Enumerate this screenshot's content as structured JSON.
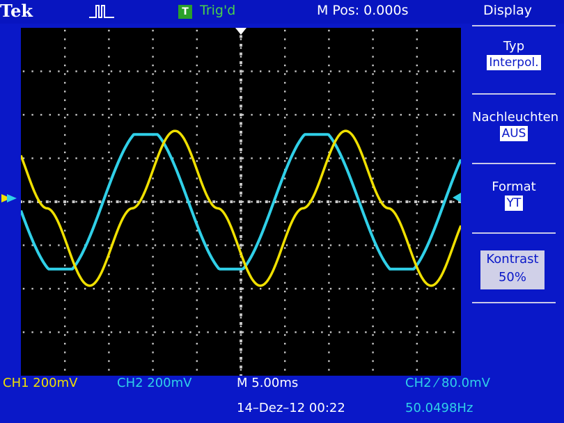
{
  "header": {
    "brand": "Tek",
    "trigger_badge": "T",
    "trigger_status": "Trig'd",
    "m_pos": "M Pos: 0.000s",
    "menu_title": "Display"
  },
  "menu": {
    "items": [
      {
        "label": "Typ",
        "value": "Interpol."
      },
      {
        "label": "Nachleuchten",
        "value": "AUS"
      },
      {
        "label": "Format",
        "value": "YT"
      },
      {
        "label": "Kontrast",
        "value": "50%"
      }
    ]
  },
  "status": {
    "ch1": "CH1  200mV",
    "ch2": "CH2  200mV",
    "timebase": "M 5.00ms",
    "trigger": "CH2 ⁄ 80.0mV",
    "datetime": "14–Dez–12 00:22",
    "frequency": "50.0498Hz"
  },
  "colors": {
    "ch1": "#f0e000",
    "ch2": "#30d0e8",
    "background": "#0a18c8",
    "screen": "#000000"
  },
  "icons": {
    "run": "pulse-icon",
    "trigger_marker": "trigger-position-marker"
  }
}
